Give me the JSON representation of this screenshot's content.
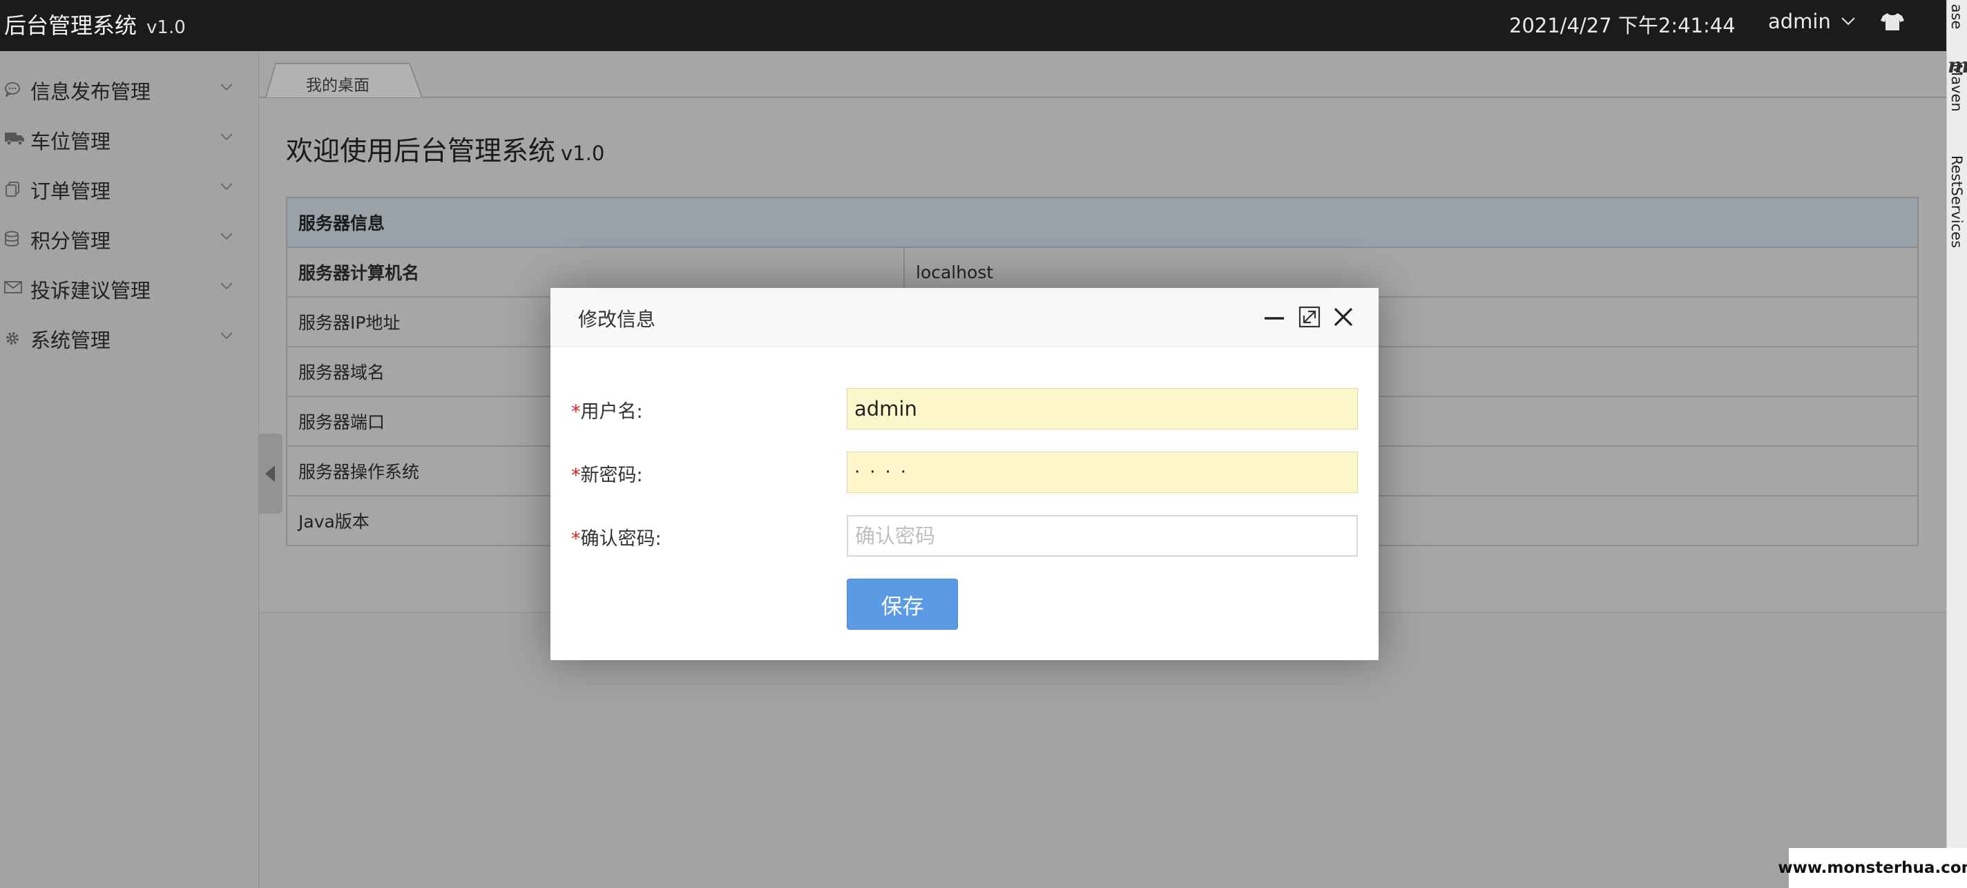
{
  "app": {
    "title": "后台管理系统",
    "version": "v1.0"
  },
  "topbar": {
    "datetime": "2021/4/27 下午2:41:44",
    "user": "admin",
    "skin_icon": "tshirt-icon"
  },
  "sidebar": {
    "items": [
      {
        "label": "信息发布管理",
        "icon": "comment-icon"
      },
      {
        "label": "车位管理",
        "icon": "truck-icon"
      },
      {
        "label": "订单管理",
        "icon": "copy-icon"
      },
      {
        "label": "积分管理",
        "icon": "database-icon"
      },
      {
        "label": "投诉建议管理",
        "icon": "envelope-icon"
      },
      {
        "label": "系统管理",
        "icon": "gear-icon"
      }
    ]
  },
  "tabs": [
    {
      "label": "我的桌面"
    }
  ],
  "main": {
    "welcome": "欢迎使用后台管理系统",
    "welcome_version": "v1.0",
    "table": {
      "header": "服务器信息",
      "rows": [
        {
          "label": "服务器计算机名",
          "value": "localhost"
        },
        {
          "label": "服务器IP地址",
          "value": ""
        },
        {
          "label": "服务器域名",
          "value": ""
        },
        {
          "label": "服务器端口",
          "value": ""
        },
        {
          "label": "服务器操作系统",
          "value": ""
        },
        {
          "label": "Java版本",
          "value": ""
        }
      ]
    }
  },
  "modal": {
    "title": "修改信息",
    "required_mark": "*",
    "fields": {
      "username": {
        "label": "用户名:",
        "value": "admin"
      },
      "new_password": {
        "label": "新密码:",
        "value": "····"
      },
      "confirm_password": {
        "label": "确认密码:",
        "value": "",
        "placeholder": "确认密码"
      }
    },
    "save_label": "保存"
  },
  "ide_strip": {
    "labels": [
      "ase",
      "Maven",
      "RestServices"
    ],
    "maven_mark": "m"
  },
  "watermark": "www.monsterhua.com",
  "colors": {
    "topbar": "#1b1b1b",
    "save_button": "#5b9be6",
    "field_highlight": "#fff7cc",
    "required": "#e02020"
  }
}
